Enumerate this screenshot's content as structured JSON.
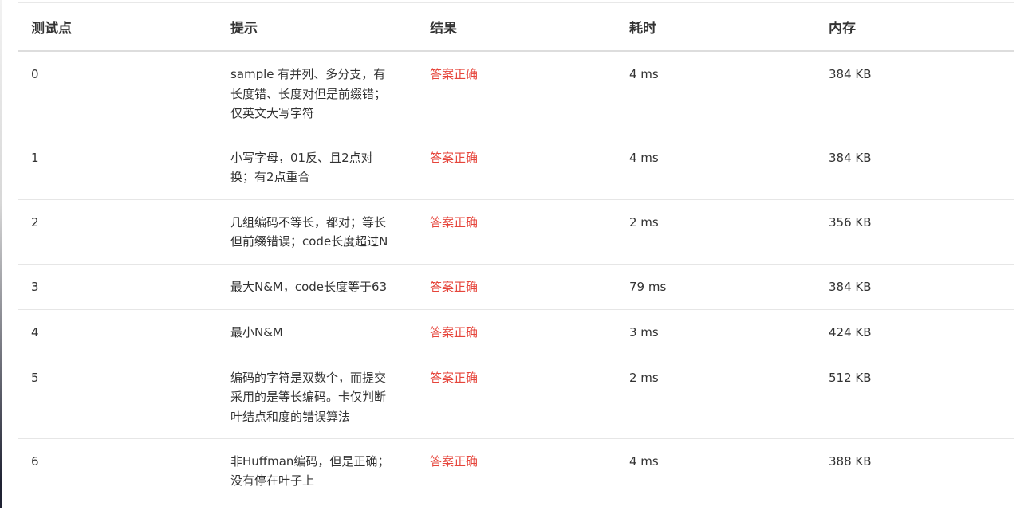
{
  "columns": {
    "id": "测试点",
    "hint": "提示",
    "result": "结果",
    "time": "耗时",
    "memory": "内存"
  },
  "rows": [
    {
      "id": "0",
      "hint": "sample 有并列、多分支，有长度错、长度对但是前缀错；仅英文大写字符",
      "result": "答案正确",
      "time": "4 ms",
      "memory": "384 KB"
    },
    {
      "id": "1",
      "hint": "小写字母，01反、且2点对换；有2点重合",
      "result": "答案正确",
      "time": "4 ms",
      "memory": "384 KB"
    },
    {
      "id": "2",
      "hint": "几组编码不等长，都对；等长但前缀错误；code长度超过N",
      "result": "答案正确",
      "time": "2 ms",
      "memory": "356 KB"
    },
    {
      "id": "3",
      "hint": "最大N&M，code长度等于63",
      "result": "答案正确",
      "time": "79 ms",
      "memory": "384 KB"
    },
    {
      "id": "4",
      "hint": "最小N&M",
      "result": "答案正确",
      "time": "3 ms",
      "memory": "424 KB"
    },
    {
      "id": "5",
      "hint": "编码的字符是双数个，而提交采用的是等长编码。卡仅判断叶结点和度的错误算法",
      "result": "答案正确",
      "time": "2 ms",
      "memory": "512 KB"
    },
    {
      "id": "6",
      "hint": "非Huffman编码，但是正确；没有停在叶子上",
      "result": "答案正确",
      "time": "4 ms",
      "memory": "388 KB"
    }
  ],
  "colors": {
    "result_accepted": "#e6453b",
    "text": "#333333",
    "divider": "#e6e6e6"
  }
}
